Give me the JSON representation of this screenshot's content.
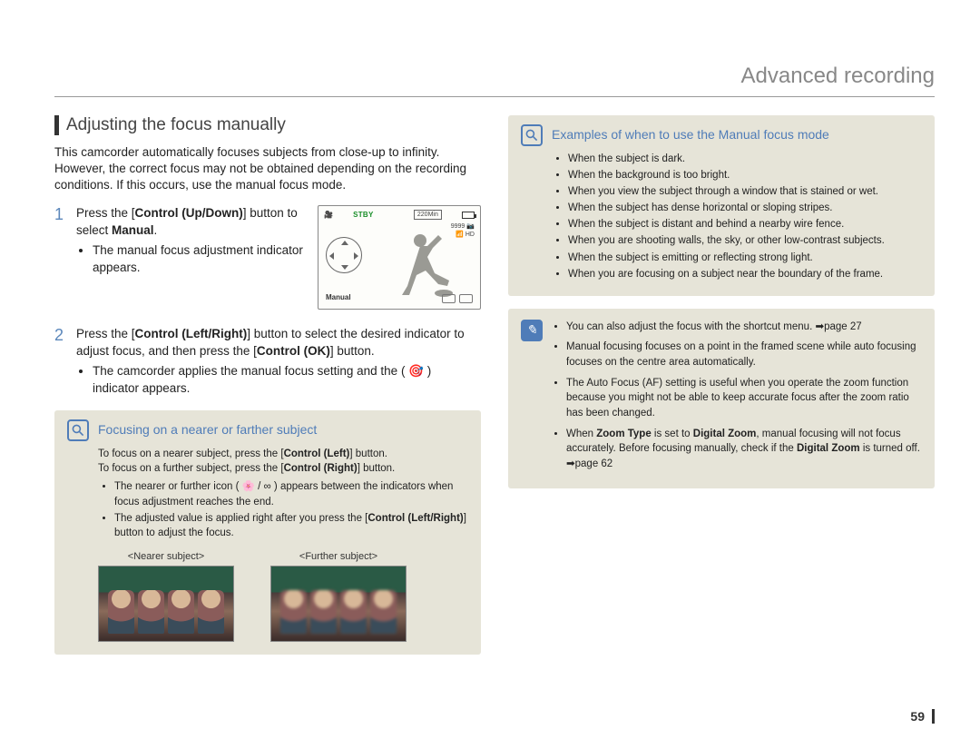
{
  "chapter": "Advanced recording",
  "pageNumber": "59",
  "section": {
    "title": "Adjusting the focus manually",
    "intro": "This camcorder automatically focuses subjects from close-up to infinity. However, the correct focus may not be obtained depending on the recording conditions. If this occurs, use the manual focus mode.",
    "steps": [
      {
        "num": "1",
        "text_a": "Press the [",
        "text_b": "Control (Up/Down)",
        "text_c": "] button to select ",
        "text_d": "Manual",
        "text_e": ".",
        "bullet": "The manual focus adjustment indicator appears."
      },
      {
        "num": "2",
        "text_a": "Press the [",
        "text_b": "Control (Left/Right)",
        "text_c": "] button to select the desired indicator to adjust focus, and then press the [",
        "text_d": "Control (OK)",
        "text_e": "] button.",
        "bullet": "The camcorder applies the manual focus setting and the ( 🎯 ) indicator appears."
      }
    ],
    "lcd": {
      "stby": "STBY",
      "time": "220Min",
      "count": "9999",
      "mode": "Manual"
    }
  },
  "nearerBox": {
    "title": "Focusing on a nearer or farther subject",
    "line1a": "To focus on a nearer subject, press the [",
    "line1b": "Control (Left)",
    "line1c": "] button.",
    "line2a": "To focus on a further subject, press the [",
    "line2b": "Control (Right)",
    "line2c": "] button.",
    "bullets": [
      "The nearer or further icon ( 🌸 / ∞ ) appears between the indicators when focus adjustment reaches the end.",
      "The adjusted value is applied right after you press the [Control (Left/Right)] button to adjust the focus."
    ],
    "bullet2_a": "The adjusted value is applied right after you press the [",
    "bullet2_b": "Control (Left/Right)",
    "bullet2_c": "] button to adjust the focus.",
    "nearerLabel": "<Nearer subject>",
    "furtherLabel": "<Further subject>"
  },
  "examplesBox": {
    "title": "Examples of when to use the Manual focus mode",
    "bullets": [
      "When the subject is dark.",
      "When the background is too bright.",
      "When you view the subject through a window that is stained or wet.",
      "When the subject has dense horizontal or sloping stripes.",
      "When the subject is distant and behind a nearby wire fence.",
      "When you are shooting walls, the sky, or other low-contrast subjects.",
      "When the subject is emitting or reflecting strong light.",
      "When you are focusing on a subject near the boundary of the frame."
    ]
  },
  "noteBox": {
    "n1": "You can also adjust the focus with the shortcut menu. ➡page 27",
    "n2": "Manual focusing focuses on a point in the framed scene while auto focusing focuses on the centre area automatically.",
    "n3": "The Auto Focus (AF) setting is useful when you operate the zoom function because you might not be able to keep accurate focus after the zoom ratio has been changed.",
    "n4_a": "When ",
    "n4_b": "Zoom Type",
    "n4_c": " is set to ",
    "n4_d": "Digital Zoom",
    "n4_e": ", manual focusing will not focus accurately. Before focusing manually, check if the ",
    "n4_f": "Digital Zoom",
    "n4_g": " is turned off. ➡page 62"
  }
}
